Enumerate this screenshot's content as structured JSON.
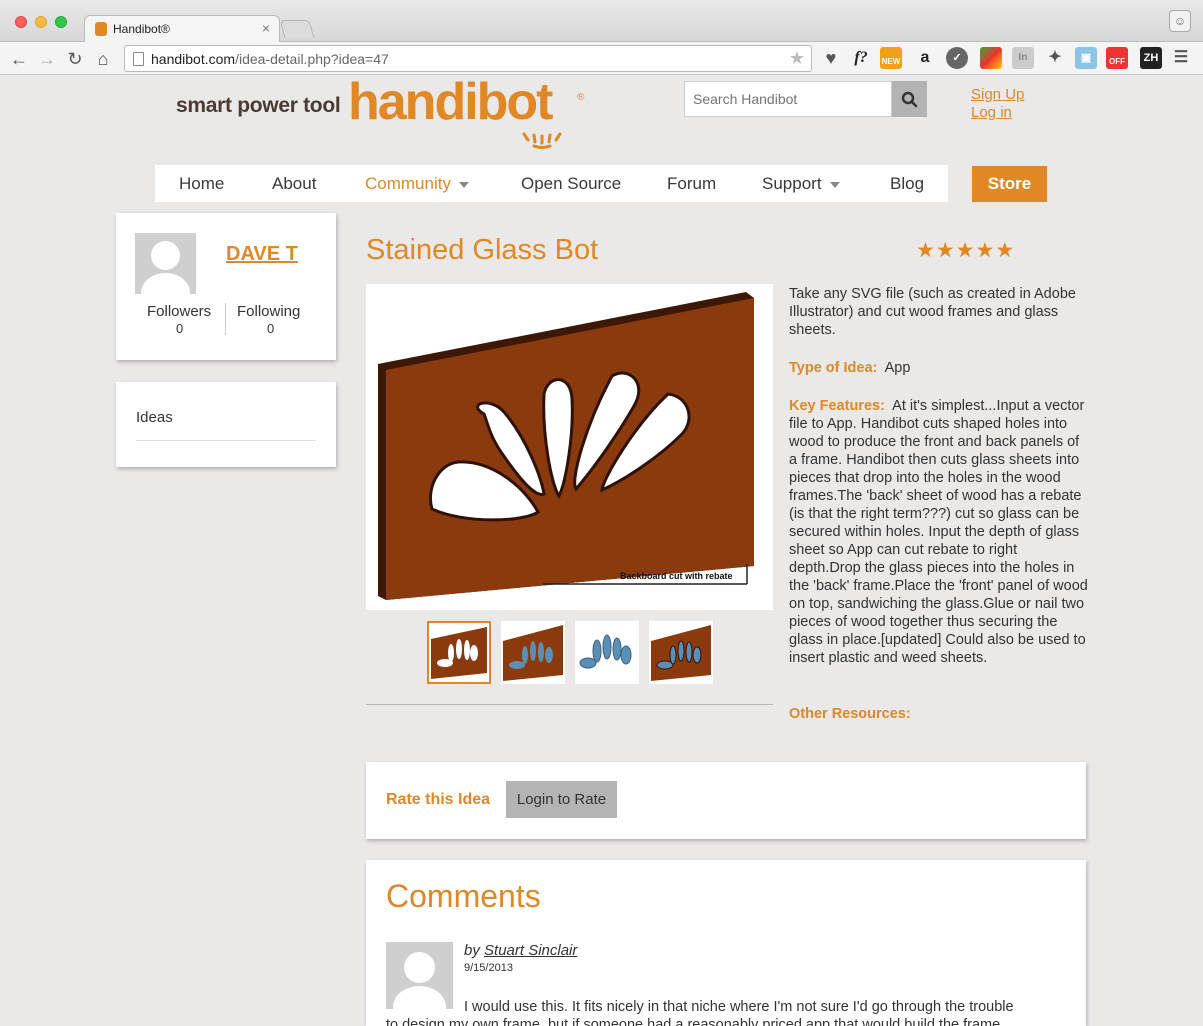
{
  "browser": {
    "tab_title": "Handibot®",
    "url_host": "handibot.com",
    "url_path": "/idea-detail.php?idea=47"
  },
  "header": {
    "tagline": "smart power tool",
    "logo": "handibot",
    "logo_mark": "®",
    "search_placeholder": "Search Handibot",
    "sign_up": "Sign Up",
    "log_in": "Log in"
  },
  "nav": {
    "items": [
      "Home",
      "About",
      "Community",
      "Open Source",
      "Forum",
      "Support",
      "Blog"
    ],
    "store": "Store"
  },
  "profile": {
    "name": "DAVE T",
    "followers_label": "Followers",
    "followers_count": "0",
    "following_label": "Following",
    "following_count": "0"
  },
  "sidebar": {
    "ideas_label": "Ideas"
  },
  "idea": {
    "title": "Stained Glass Bot",
    "rating": 5,
    "image_caption": "Backboard cut with rebate",
    "description": "Take any SVG file (such as created in Adobe Illustrator) and cut wood frames and glass sheets.",
    "type_label": "Type of Idea:",
    "type_value": "App",
    "features_label": "Key Features:",
    "features_value": "At it's simplest...Input a vector file to App. Handibot cuts shaped holes into wood to produce the front and back panels of a frame. Handibot then cuts glass sheets into pieces that drop into the holes in the wood frames.The 'back' sheet of wood has a rebate (is that the right term???) cut so glass can be secured within holes. Input the depth of glass sheet so App can cut rebate to right depth.Drop the glass pieces into the holes in the 'back' frame.Place the 'front' panel of wood on top, sandwiching the glass.Glue or nail two pieces of wood together thus securing the glass in place.[updated] Could also be used to insert plastic and weed sheets.",
    "resources_label": "Other Resources:"
  },
  "rate": {
    "label": "Rate this Idea",
    "button": "Login to Rate"
  },
  "comments": {
    "title": "Comments",
    "items": [
      {
        "by": "by",
        "author": "Stuart Sinclair",
        "date": "9/15/2013",
        "text_line1": "I would use this. It fits nicely in that niche where I'm not sure I'd go through the trouble",
        "text_line2": "to design my own frame, but if someone had a reasonably priced app that would build the frame"
      }
    ]
  },
  "colors": {
    "accent": "#e08726",
    "wood": "#8b3a0e",
    "glass_blue": "#5b8fb5",
    "page_bg": "#ebe9e8"
  }
}
